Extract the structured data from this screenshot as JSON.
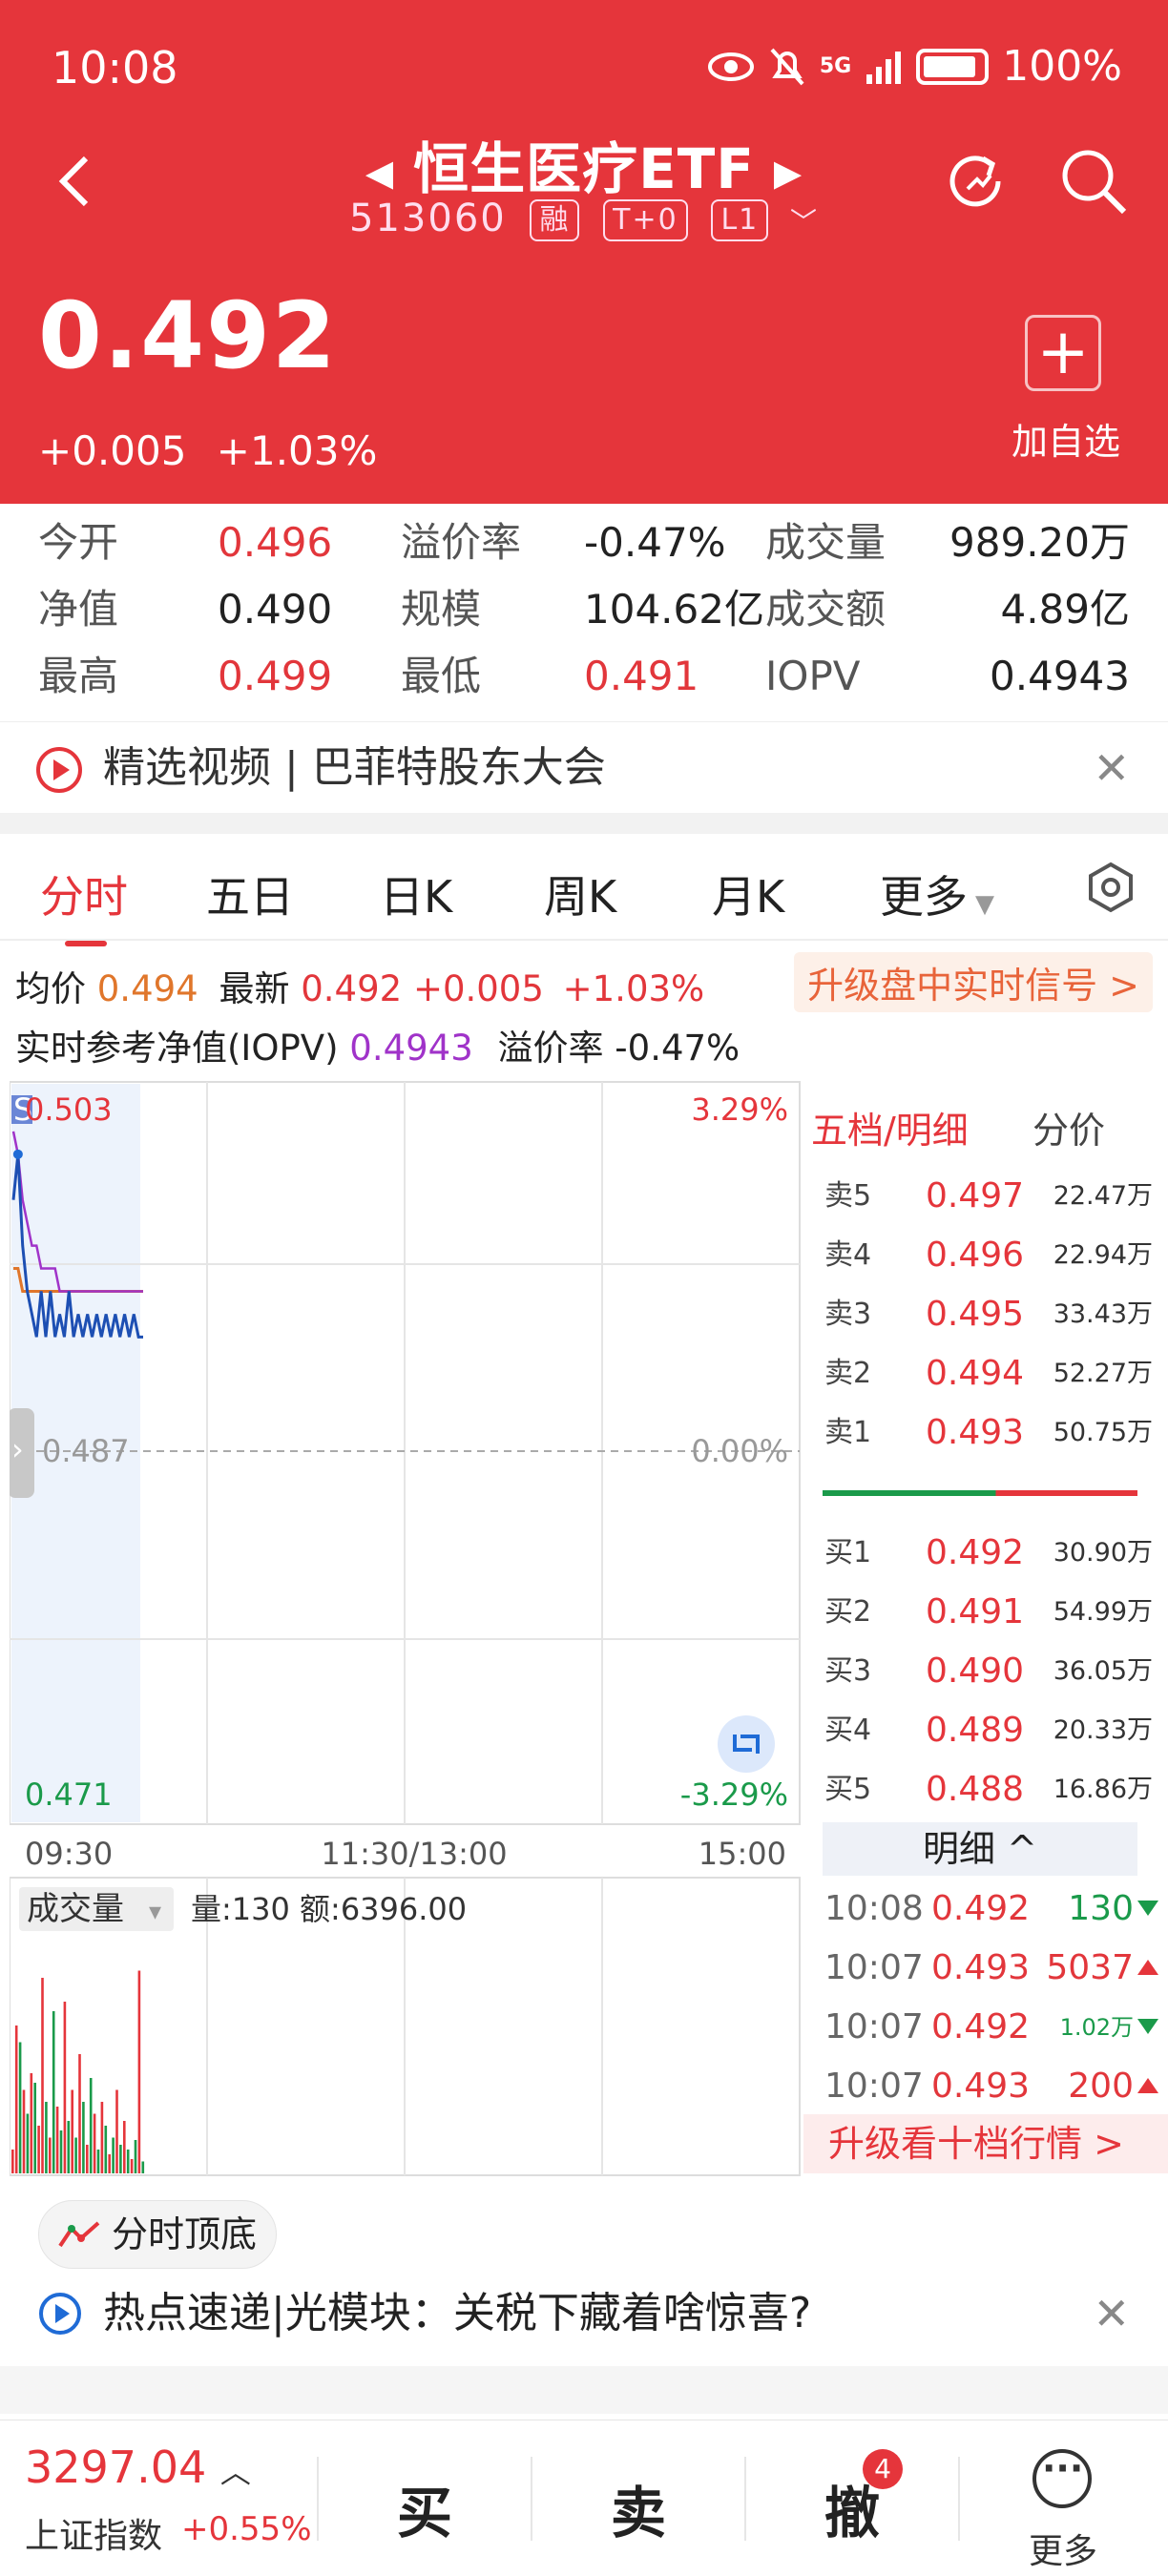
{
  "status_bar": {
    "time": "10:08",
    "network": "5G",
    "battery": "100%"
  },
  "header": {
    "name": "恒生医疗ETF",
    "code": "513060",
    "tags": [
      "融",
      "T+0",
      "L1"
    ],
    "price": "0.492",
    "change": "+0.005",
    "change_pct": "+1.03%",
    "add_label": "加自选"
  },
  "stats": [
    [
      {
        "l": "今开",
        "v": "0.496",
        "c": "red"
      },
      {
        "l": "溢价率",
        "v": "-0.47%",
        "c": "dark"
      },
      {
        "l": "成交量",
        "v": "989.20万",
        "c": "dark"
      }
    ],
    [
      {
        "l": "净值",
        "v": "0.490",
        "c": "dark"
      },
      {
        "l": "规模",
        "v": "104.62亿",
        "c": "dark"
      },
      {
        "l": "成交额",
        "v": "4.89亿",
        "c": "dark"
      }
    ],
    [
      {
        "l": "最高",
        "v": "0.499",
        "c": "red"
      },
      {
        "l": "最低",
        "v": "0.491",
        "c": "red"
      },
      {
        "l": "IOPV",
        "v": "0.4943",
        "c": "dark"
      }
    ]
  ],
  "news_top": "精选视频 | 巴菲特股东大会",
  "tabs": [
    "分时",
    "五日",
    "日K",
    "周K",
    "月K",
    "更多"
  ],
  "info": {
    "avg_label": "均价",
    "avg": "0.494",
    "latest_label": "最新",
    "latest": "0.492",
    "chg": "+0.005",
    "pct": "+1.03%",
    "iopv_label": "实时参考净值(IOPV)",
    "iopv": "0.4943",
    "prem_label": "溢价率",
    "prem": "-0.47%",
    "upgrade": "升级盘中实时信号 >"
  },
  "chart_data": {
    "type": "line",
    "title": "",
    "x_ticks": [
      "09:30",
      "11:30/13:00",
      "15:00"
    ],
    "y_left": {
      "top": "0.503",
      "mid": "0.487",
      "bottom": "0.471"
    },
    "y_right": {
      "top": "3.29%",
      "mid": "0.00%",
      "bottom": "-3.29%"
    },
    "ylim": [
      0.471,
      0.503
    ],
    "reference": 0.487,
    "price_series": [
      0.498,
      0.5,
      0.496,
      0.494,
      0.493,
      0.492,
      0.494,
      0.492,
      0.494,
      0.492,
      0.493,
      0.492,
      0.494,
      0.492,
      0.493,
      0.492,
      0.493,
      0.492,
      0.493,
      0.492,
      0.493,
      0.492,
      0.493,
      0.492,
      0.493,
      0.492,
      0.493,
      0.492,
      0.492
    ],
    "avg_series": [
      0.501,
      0.5,
      0.498,
      0.497,
      0.496,
      0.496,
      0.495,
      0.495,
      0.495,
      0.495,
      0.494,
      0.494,
      0.494,
      0.494,
      0.494,
      0.494,
      0.494,
      0.494,
      0.494,
      0.494,
      0.494,
      0.494,
      0.494,
      0.494,
      0.494,
      0.494,
      0.494,
      0.494,
      0.494
    ],
    "iopv_series": [
      0.495,
      0.495,
      0.494,
      0.494,
      0.494,
      0.494,
      0.494,
      0.494,
      0.494,
      0.494,
      0.494,
      0.494,
      0.494,
      0.494,
      0.494,
      0.494,
      0.494,
      0.494,
      0.494,
      0.494,
      0.494,
      0.494,
      0.494,
      0.494,
      0.494,
      0.494,
      0.494,
      0.494,
      0.494
    ],
    "volume_label": "成交量",
    "volume_info": "量:130 额:6396.00",
    "volume_bars": [
      0.1,
      0.62,
      0.55,
      0.35,
      0.25,
      0.42,
      0.38,
      0.2,
      0.82,
      0.3,
      0.15,
      0.68,
      0.28,
      0.18,
      0.72,
      0.22,
      0.35,
      0.15,
      0.5,
      0.3,
      0.12,
      0.4,
      0.25,
      0.1,
      0.3,
      0.2,
      0.08,
      0.15,
      0.35,
      0.12,
      0.22,
      0.1,
      0.06,
      0.14,
      0.85,
      0.05
    ],
    "volume_colors": [
      "r",
      "r",
      "g",
      "r",
      "g",
      "r",
      "g",
      "r",
      "r",
      "g",
      "r",
      "g",
      "r",
      "g",
      "r",
      "g",
      "r",
      "g",
      "r",
      "g",
      "r",
      "g",
      "r",
      "g",
      "r",
      "g",
      "r",
      "g",
      "r",
      "g",
      "r",
      "g",
      "r",
      "g",
      "r",
      "g"
    ]
  },
  "order_book": {
    "header": "五档/明细",
    "header2": "分价",
    "sells": [
      {
        "label": "卖5",
        "price": "0.497",
        "vol": "22.47万"
      },
      {
        "label": "卖4",
        "price": "0.496",
        "vol": "22.94万"
      },
      {
        "label": "卖3",
        "price": "0.495",
        "vol": "33.43万"
      },
      {
        "label": "卖2",
        "price": "0.494",
        "vol": "52.27万"
      },
      {
        "label": "卖1",
        "price": "0.493",
        "vol": "50.75万"
      }
    ],
    "buys": [
      {
        "label": "买1",
        "price": "0.492",
        "vol": "30.90万"
      },
      {
        "label": "买2",
        "price": "0.491",
        "vol": "54.99万"
      },
      {
        "label": "买3",
        "price": "0.490",
        "vol": "36.05万"
      },
      {
        "label": "买4",
        "price": "0.489",
        "vol": "20.33万"
      },
      {
        "label": "买5",
        "price": "0.488",
        "vol": "16.86万"
      }
    ],
    "detail_header": "明细 ^",
    "details": [
      {
        "time": "10:08",
        "price": "0.492",
        "vol": "130",
        "dir": "down",
        "pc": "red"
      },
      {
        "time": "10:07",
        "price": "0.493",
        "vol": "5037",
        "dir": "up",
        "pc": "red"
      },
      {
        "time": "10:07",
        "price": "0.492",
        "vol": "1.02万",
        "dir": "down",
        "pc": "red"
      },
      {
        "time": "10:07",
        "price": "0.493",
        "vol": "200",
        "dir": "up",
        "pc": "red"
      }
    ],
    "upgrade": "升级看十档行情 >"
  },
  "chip": "分时顶底",
  "news_bottom": "热点速递|光模块：关税下藏着啥惊喜?",
  "bottom_bar": {
    "index_value": "3297.04",
    "index_name": "上证指数",
    "index_pct": "+0.55%",
    "buy": "买",
    "sell": "卖",
    "cancel": "撤",
    "cancel_badge": "4",
    "more": "更多"
  },
  "colors": {
    "red": "#e5353b",
    "green": "#1a9a4a",
    "blue": "#1d4fb3",
    "purple": "#a033c9",
    "orange": "#e0762b"
  }
}
